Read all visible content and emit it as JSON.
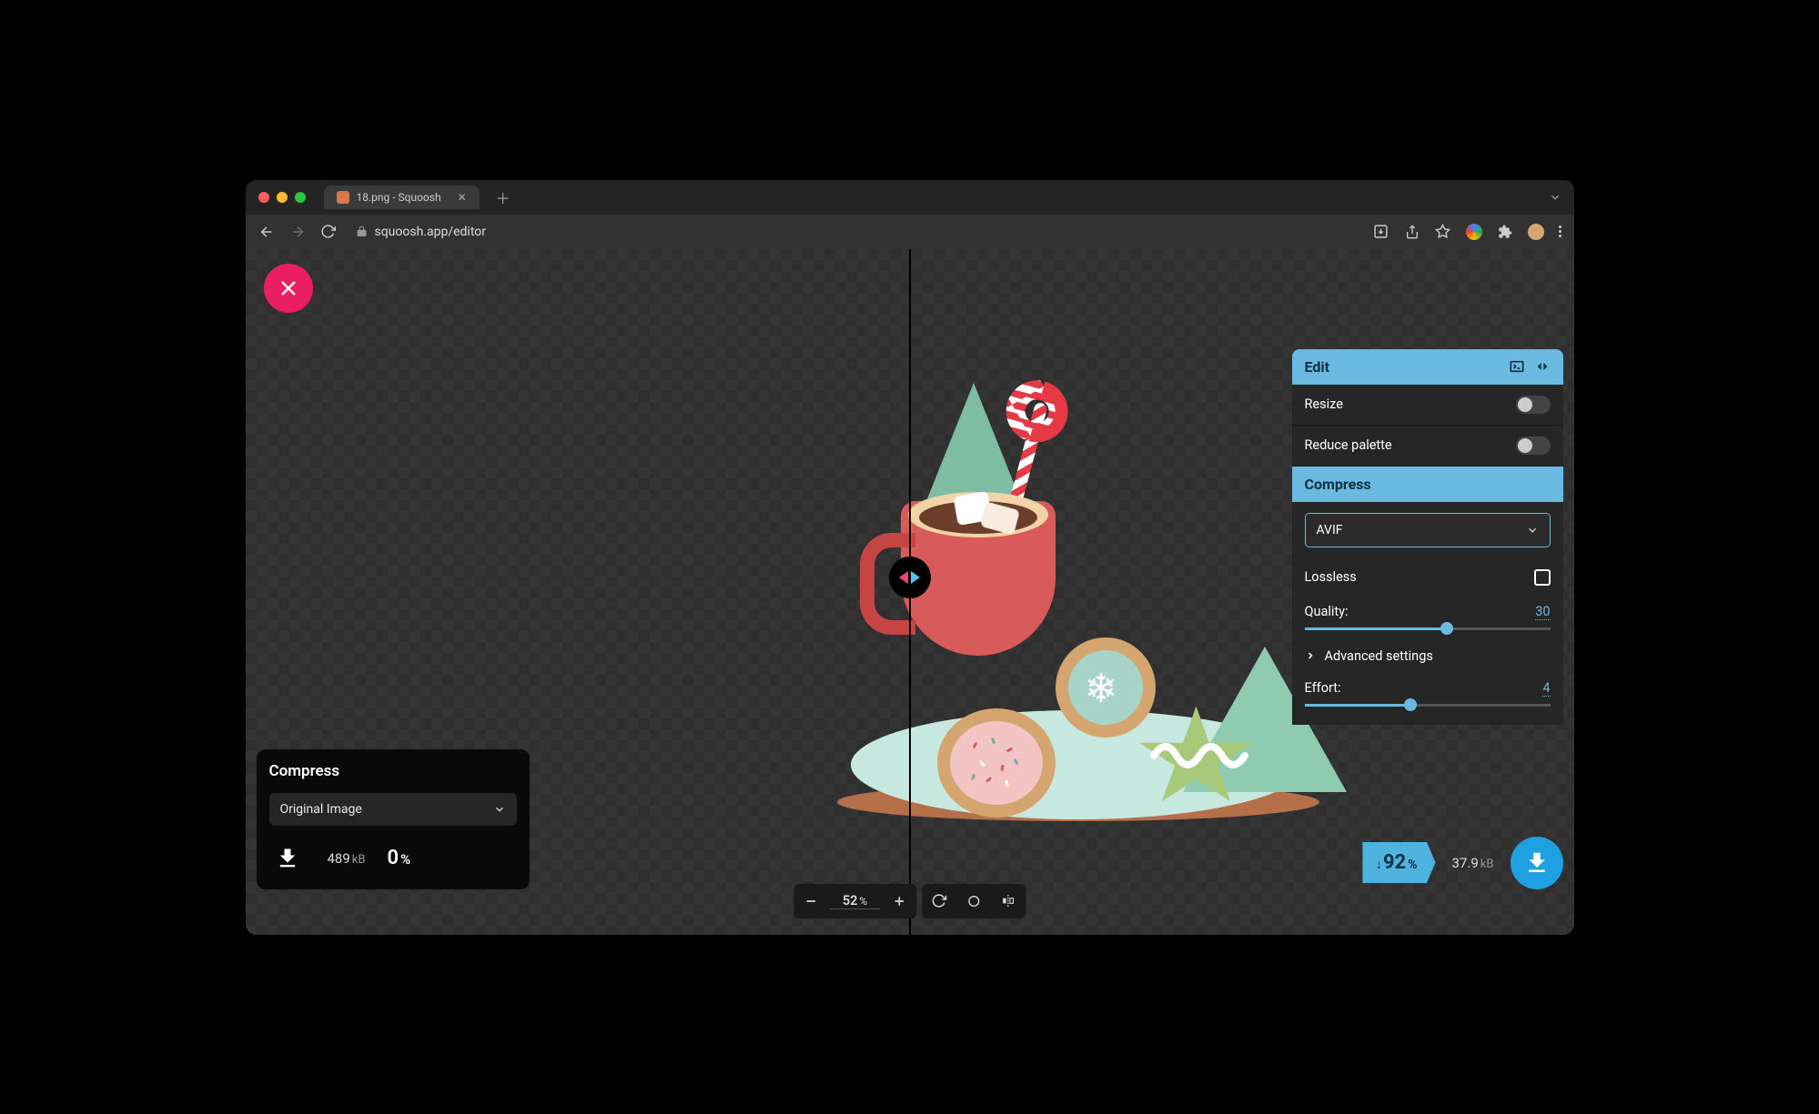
{
  "browser": {
    "tab_title": "18.png - Squoosh",
    "url": "squoosh.app/editor"
  },
  "left_panel": {
    "title": "Compress",
    "codec_label": "Original Image",
    "filesize_value": "489",
    "filesize_unit": "kB",
    "savings_value": "0",
    "savings_unit": "%"
  },
  "right_panel": {
    "edit_title": "Edit",
    "resize_label": "Resize",
    "resize_on": false,
    "reduce_palette_label": "Reduce palette",
    "reduce_palette_on": false,
    "compress_title": "Compress",
    "codec_label": "AVIF",
    "lossless_label": "Lossless",
    "lossless_checked": false,
    "quality_label": "Quality:",
    "quality_value": "30",
    "advanced_label": "Advanced settings",
    "effort_label": "Effort:",
    "effort_value": "4"
  },
  "right_stats": {
    "savings_direction": "↓",
    "savings_value": "92",
    "savings_unit": "%",
    "filesize_value": "37.9",
    "filesize_unit": "kB"
  },
  "zoom": {
    "value": "52",
    "unit": "%"
  }
}
